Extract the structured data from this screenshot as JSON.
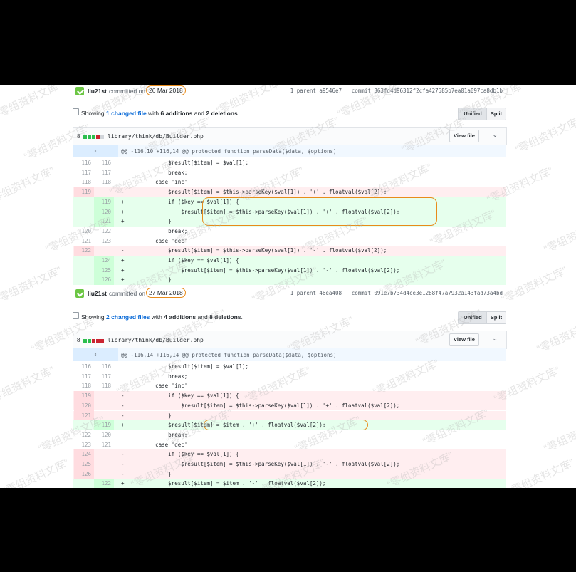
{
  "commit1": {
    "author": "liu21st",
    "committed": "committed on",
    "date": "26 Mar 2018",
    "parent": "1 parent a9546e7",
    "sha": "commit 363fd4d96312f2cfa427585b7ea01a097ca8db1b"
  },
  "summary1": {
    "prefix": "Showing",
    "changed": "1 changed file",
    "mid": "with",
    "additions": "6 additions",
    "and": "and",
    "deletions": "2 deletions",
    "end": "."
  },
  "commit2": {
    "author": "liu21st",
    "committed": "committed on",
    "date": "27 Mar 2018",
    "parent": "1 parent 46ea408",
    "sha": "commit 091e7b734d4ce3e1288f47a7932a143fad73a4bd"
  },
  "summary2": {
    "prefix": "Showing",
    "changed": "2 changed files",
    "mid": "with",
    "additions": "4 additions",
    "and": "and",
    "deletions": "8 deletions",
    "end": "."
  },
  "buttons": {
    "unified": "Unified",
    "split": "Split",
    "view_file": "View file"
  },
  "file": {
    "count": "8",
    "path": "library/think/db/Builder.php"
  },
  "hunk1": {
    "expand": "⇕",
    "text": "@@ -116,10 +116,14 @@ protected function parseData($data, $options)"
  },
  "hunk2": {
    "expand": "⇕",
    "text": "@@ -116,14 +116,14 @@ protected function parseData($data, $options)"
  },
  "diff1": [
    {
      "type": "ctx",
      "l": "116",
      "r": "116",
      "s": "",
      "c": "            $result[$item] = $val[1];"
    },
    {
      "type": "ctx",
      "l": "117",
      "r": "117",
      "s": "",
      "c": "            break;"
    },
    {
      "type": "ctx",
      "l": "118",
      "r": "118",
      "s": "",
      "c": "        case 'inc':"
    },
    {
      "type": "del",
      "l": "119",
      "r": "",
      "s": "-",
      "c": "            $result[$item] = $this->parseKey($val[1]) . '+' . floatval($val[2]);"
    },
    {
      "type": "add",
      "l": "",
      "r": "119",
      "s": "+",
      "c": "            if ($key == $val[1]) {"
    },
    {
      "type": "add",
      "l": "",
      "r": "120",
      "s": "+",
      "c": "                $result[$item] = $this->parseKey($val[1]) . '+' . floatval($val[2]);"
    },
    {
      "type": "add",
      "l": "",
      "r": "121",
      "s": "+",
      "c": "            }"
    },
    {
      "type": "ctx",
      "l": "120",
      "r": "122",
      "s": "",
      "c": "            break;"
    },
    {
      "type": "ctx",
      "l": "121",
      "r": "123",
      "s": "",
      "c": "        case 'dec':"
    },
    {
      "type": "del",
      "l": "122",
      "r": "",
      "s": "-",
      "c": "            $result[$item] = $this->parseKey($val[1]) . '-' . floatval($val[2]);"
    },
    {
      "type": "add",
      "l": "",
      "r": "124",
      "s": "+",
      "c": "            if ($key == $val[1]) {"
    },
    {
      "type": "add",
      "l": "",
      "r": "125",
      "s": "+",
      "c": "                $result[$item] = $this->parseKey($val[1]) . '-' . floatval($val[2]);"
    },
    {
      "type": "add",
      "l": "",
      "r": "126",
      "s": "+",
      "c": "            }"
    }
  ],
  "diff2": [
    {
      "type": "ctx",
      "l": "116",
      "r": "116",
      "s": "",
      "c": "            $result[$item] = $val[1];"
    },
    {
      "type": "ctx",
      "l": "117",
      "r": "117",
      "s": "",
      "c": "            break;"
    },
    {
      "type": "ctx",
      "l": "118",
      "r": "118",
      "s": "",
      "c": "        case 'inc':"
    },
    {
      "type": "del",
      "l": "119",
      "r": "",
      "s": "-",
      "c": "            if ($key == $val[1]) {"
    },
    {
      "type": "del",
      "l": "120",
      "r": "",
      "s": "-",
      "c": "                $result[$item] = $this->parseKey($val[1]) . '+' . floatval($val[2]);"
    },
    {
      "type": "del",
      "l": "121",
      "r": "",
      "s": "-",
      "c": "            }"
    },
    {
      "type": "add",
      "l": "",
      "r": "119",
      "s": "+",
      "c": "            $result[$item] = $item . '+' . floatval($val[2]);"
    },
    {
      "type": "ctx",
      "l": "122",
      "r": "120",
      "s": "",
      "c": "            break;"
    },
    {
      "type": "ctx",
      "l": "123",
      "r": "121",
      "s": "",
      "c": "        case 'dec':"
    },
    {
      "type": "del",
      "l": "124",
      "r": "",
      "s": "-",
      "c": "            if ($key == $val[1]) {"
    },
    {
      "type": "del",
      "l": "125",
      "r": "",
      "s": "-",
      "c": "                $result[$item] = $this->parseKey($val[1]) . '-' . floatval($val[2]);"
    },
    {
      "type": "del",
      "l": "126",
      "r": "",
      "s": "-",
      "c": "            }"
    },
    {
      "type": "add",
      "l": "",
      "r": "122",
      "s": "+",
      "c": "            $result[$item] = $item . '-' . floatval($val[2]);"
    }
  ],
  "watermark": "“零组资料文库”",
  "colors": {
    "accent_orange": "#e88b1a",
    "add_bg": "#e6ffed",
    "del_bg": "#ffeef0",
    "link": "#0366d6"
  }
}
